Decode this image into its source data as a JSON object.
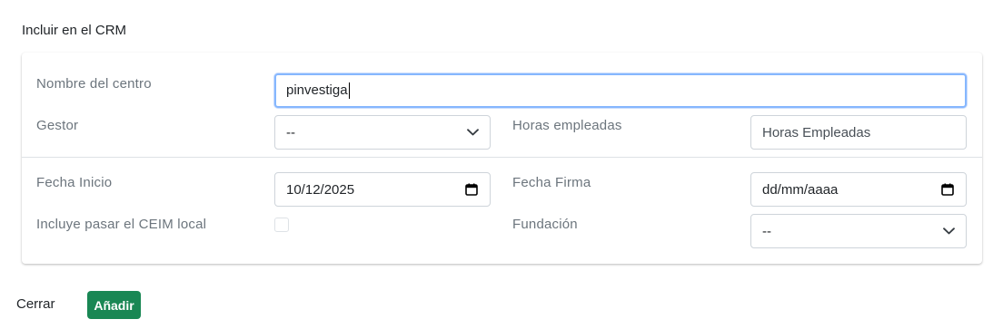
{
  "modal": {
    "title": "Incluir en el CRM"
  },
  "form": {
    "nombre_centro": {
      "label": "Nombre del centro",
      "value": "pinvestiga"
    },
    "gestor": {
      "label": "Gestor",
      "value": "--"
    },
    "horas": {
      "label": "Horas empleadas",
      "placeholder": "Horas Empleadas"
    },
    "fecha_inicio": {
      "label": "Fecha Inicio",
      "value": "10/12/2025"
    },
    "fecha_firma": {
      "label": "Fecha Firma",
      "placeholder": "dd/mm/aaaa"
    },
    "ceim": {
      "label": "Incluye pasar el CEIM local",
      "checked": false
    },
    "fundacion": {
      "label": "Fundación",
      "value": "--"
    }
  },
  "footer": {
    "close_label": "Cerrar",
    "add_label": "Añadir"
  },
  "colors": {
    "add_button": "#198754",
    "focus_border": "#86b7fe",
    "label": "#6c757d"
  },
  "icons": {
    "select": "chevron-down-icon",
    "date": "calendar-icon"
  }
}
